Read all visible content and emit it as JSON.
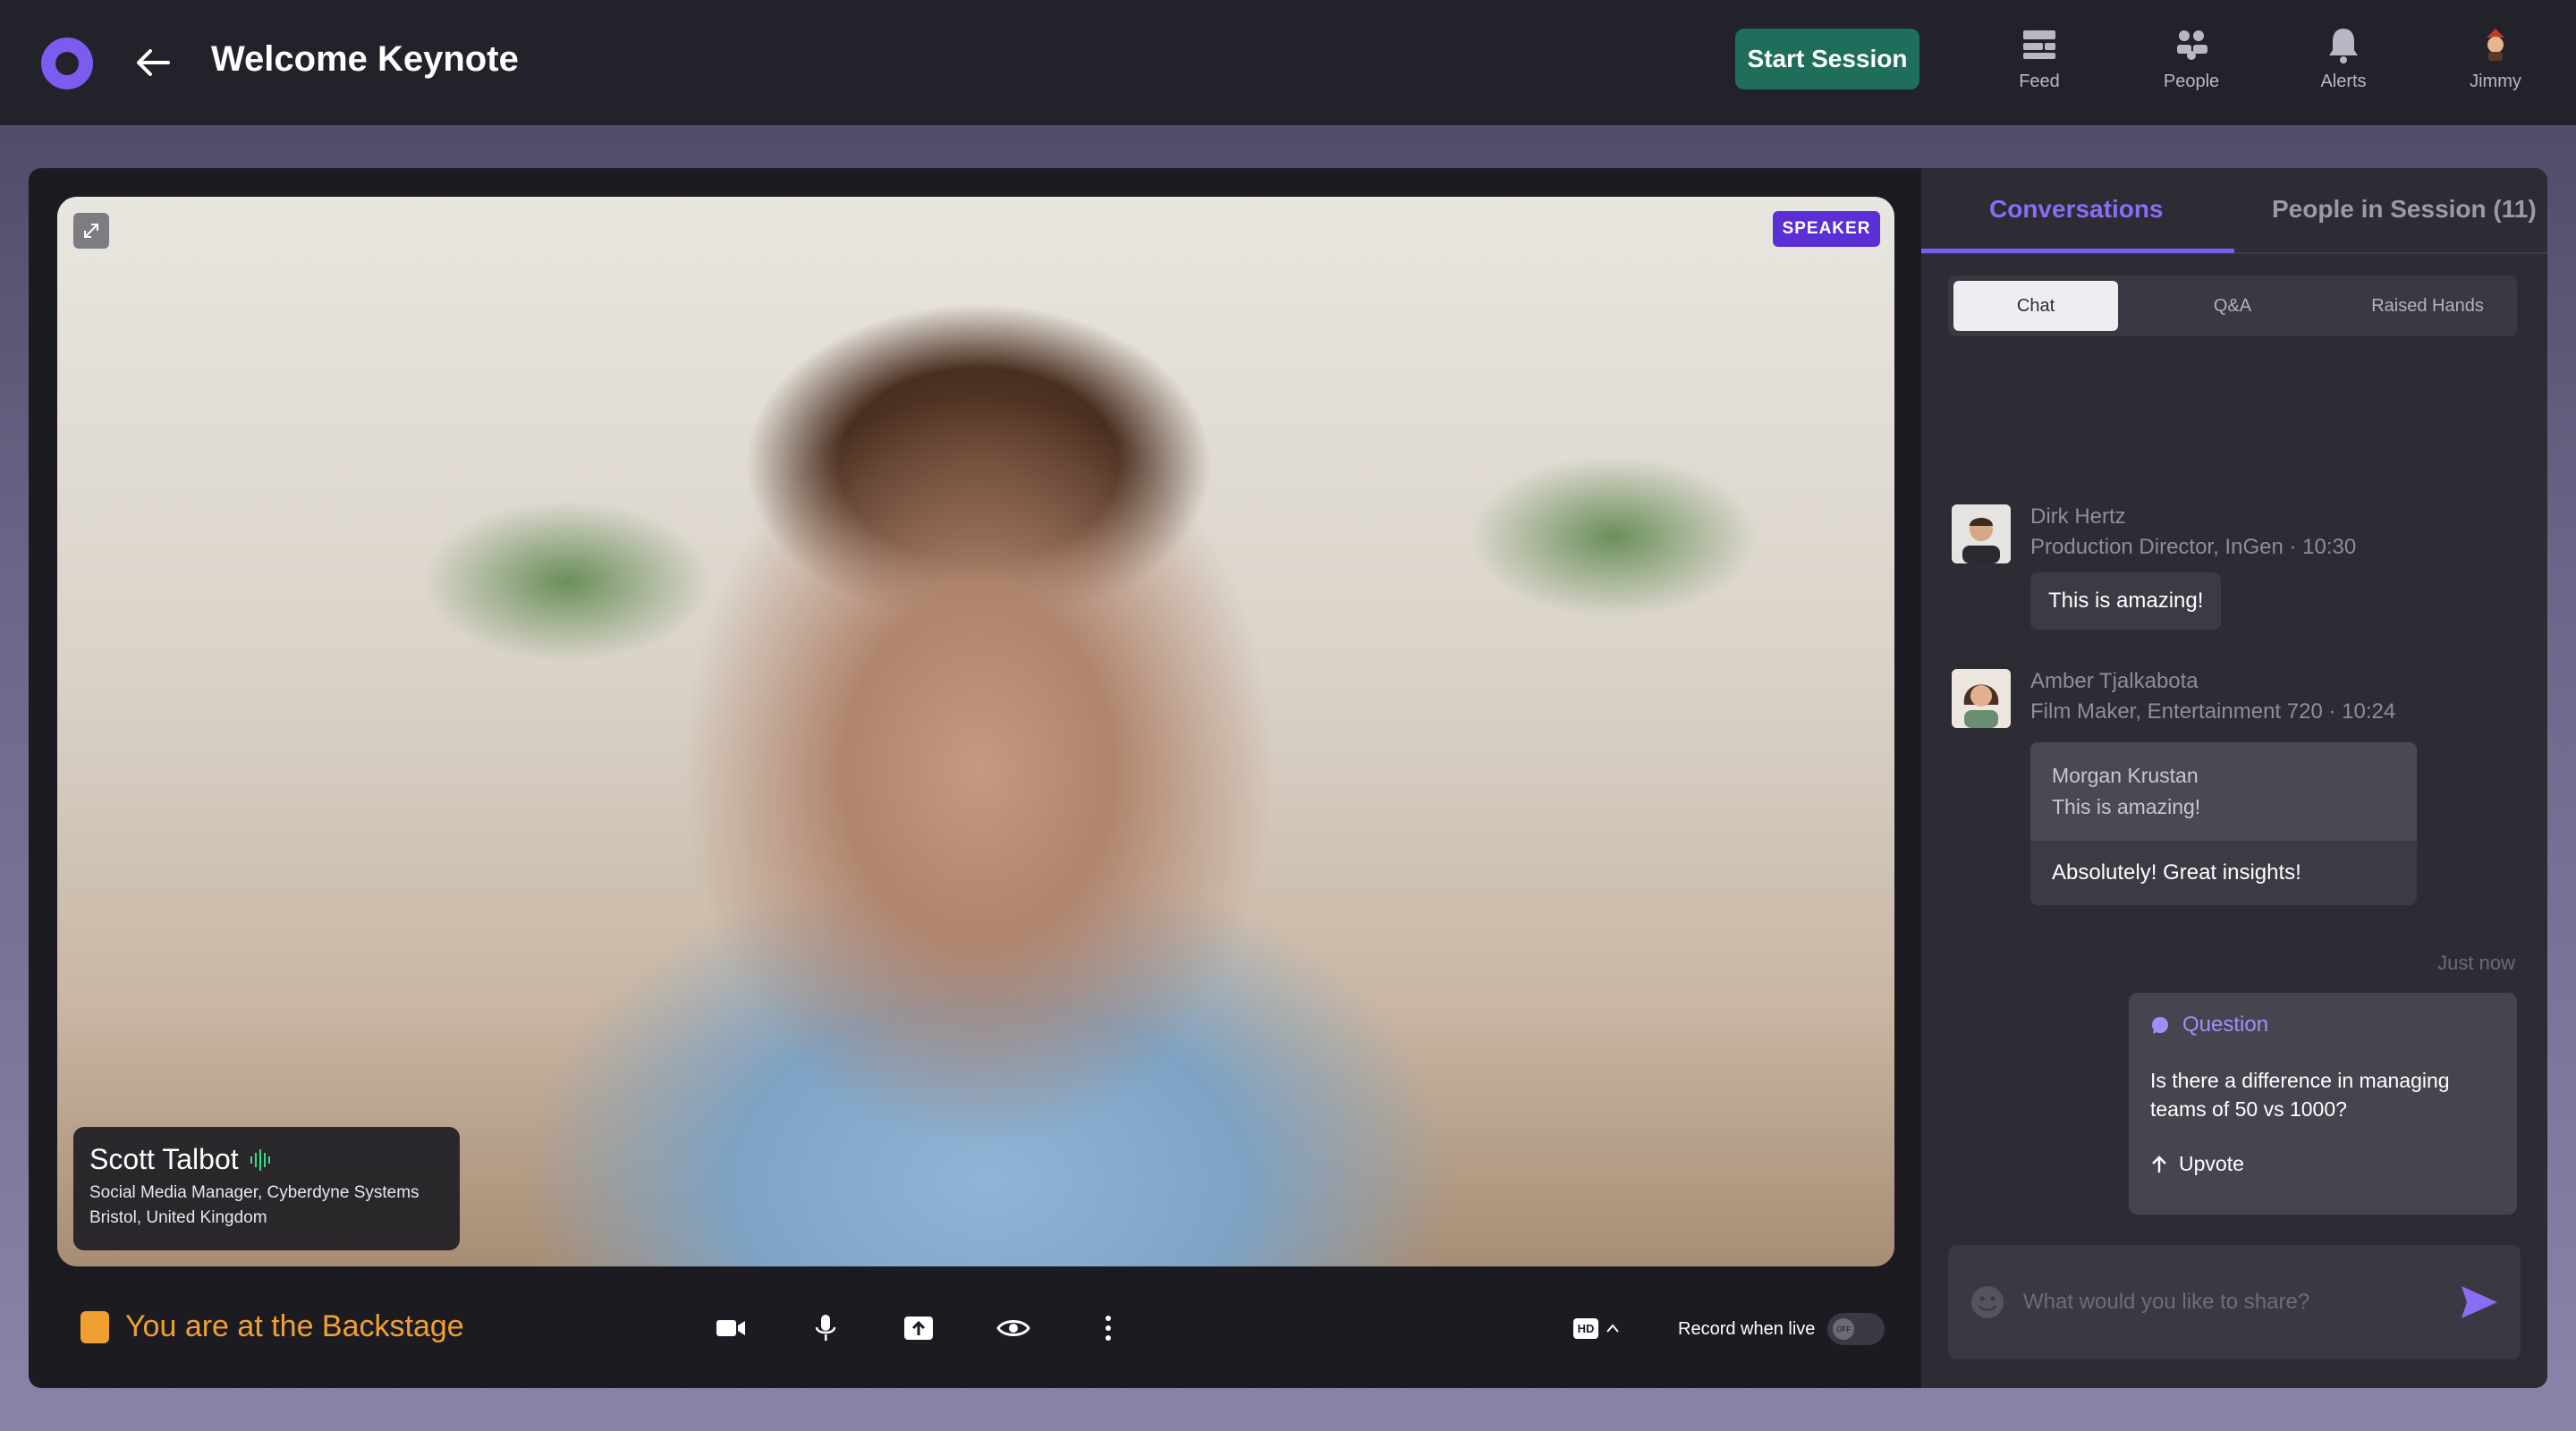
{
  "header": {
    "title": "Welcome Keynote",
    "start_button": "Start Session",
    "nav": [
      {
        "label": "Feed",
        "icon": "feed-icon"
      },
      {
        "label": "People",
        "icon": "people-icon"
      },
      {
        "label": "Alerts",
        "icon": "bell-icon"
      },
      {
        "label": "Jimmy",
        "icon": "user-avatar"
      }
    ]
  },
  "video": {
    "badge": "SPEAKER",
    "speaker_name": "Scott Talbot",
    "speaker_role": "Social Media Manager, Cyberdyne Systems",
    "speaker_location": "Bristol, United Kingdom"
  },
  "controls": {
    "status": "You are at the Backstage",
    "quality": "HD",
    "record_label": "Record when live",
    "record_state": "OFF"
  },
  "panel": {
    "tabs": [
      "Conversations",
      "People in Session (11)"
    ],
    "subtabs": [
      "Chat",
      "Q&A",
      "Raised Hands"
    ],
    "messages": [
      {
        "name": "Dirk Hertz",
        "meta": "Production Director, InGen · 10:30",
        "text": "This is amazing!"
      },
      {
        "name": "Amber Tjalkabota",
        "meta": "Film Maker, Entertainment 720 · 10:24",
        "quote_author": "Morgan Krustan",
        "quote_text": "This is amazing!",
        "text": "Absolutely! Great insights!"
      }
    ],
    "just_now": "Just now",
    "question": {
      "label": "Question",
      "text": "Is there a difference in managing teams of 50 vs 1000?",
      "upvote": "Upvote"
    },
    "composer_placeholder": "What would you like to share?"
  },
  "colors": {
    "accent": "#7c5cf0",
    "start_button": "#1f6e5c",
    "backstage": "#f0a030",
    "speaker_badge": "#5a2fd6"
  }
}
